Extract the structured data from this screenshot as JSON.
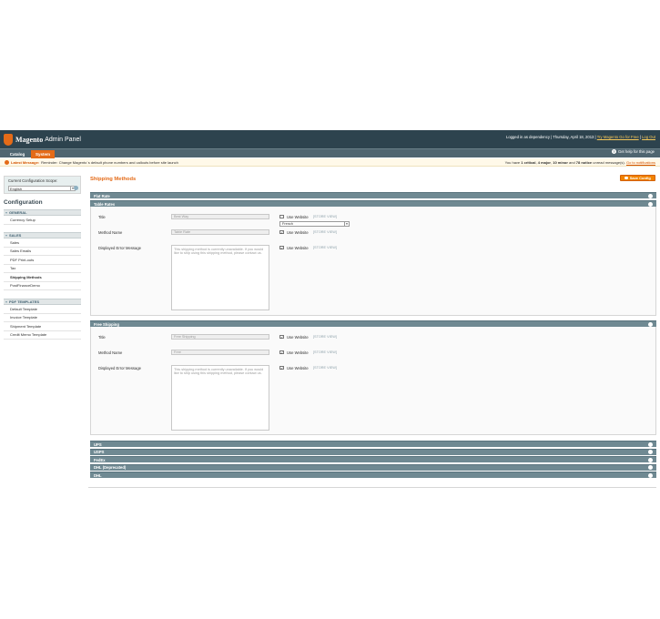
{
  "header": {
    "brand": "Magento",
    "product": "Admin Panel",
    "logged_in": "Logged in as dependency",
    "date": "Thursday, April 18, 2013",
    "try_link": "Try Magento Go for Free",
    "logout": "Log Out"
  },
  "nav": {
    "tabs": [
      {
        "label": "Catalog"
      },
      {
        "label": "System"
      }
    ],
    "help": "Get help for this page"
  },
  "notice": {
    "label": "Latest Message:",
    "text": "Reminder: Change Magento`s default phone numbers and callouts before site launch",
    "summary_prefix": "You have",
    "critical": "1 critical",
    "major": "4 major",
    "minor": "10 minor",
    "notice_count": "78 notice",
    "summary_suffix": "unread message(s).",
    "go_link": "Go to notifications"
  },
  "sidebar": {
    "scope_label": "Current Configuration Scope:",
    "scope_value": "English",
    "title": "Configuration",
    "groups": [
      {
        "label": "GENERAL",
        "items": [
          "Currency Setup"
        ]
      },
      {
        "label": "SALES",
        "items": [
          "Sales",
          "Sales Emails",
          "PDF Print-outs",
          "Tax",
          "Shipping Methods",
          "PostFinanceDemo"
        ]
      },
      {
        "label": "PDF TEMPLATES",
        "items": [
          "Default Template",
          "Invoice Template",
          "Shipment Template",
          "Credit Memo Template"
        ]
      }
    ],
    "active_item": "Shipping Methods"
  },
  "main": {
    "title": "Shipping Methods",
    "save_label": "Save Config",
    "sections": {
      "flat_rate": "Flat Rate",
      "table_rates": "Table Rates",
      "free_shipping": "Free Shipping",
      "ups": "UPS",
      "usps": "USPS",
      "fedex": "FedEx",
      "dhl_deprecated": "DHL (Deprecated)",
      "dhl": "DHL"
    },
    "table_rates": {
      "title_label": "Title",
      "title_value": "Best Way",
      "method_label": "Method Name",
      "method_value": "Table Rate",
      "error_label": "Displayed Error Message",
      "error_value": "This shipping method is currently unavailable. If you would like to ship using this shipping method, please contact us.",
      "use_website": "Use Website",
      "store_view": "[STORE VIEW]",
      "lang_select": "French"
    },
    "free_shipping": {
      "title_label": "Title",
      "title_value": "Free Shipping",
      "method_label": "Method Name",
      "method_value": "Free",
      "error_label": "Displayed Error Message",
      "error_value": "This shipping method is currently unavailable. If you would like to ship using this shipping method, please contact us.",
      "use_website": "Use Website",
      "store_view": "[STORE VIEW]"
    }
  }
}
